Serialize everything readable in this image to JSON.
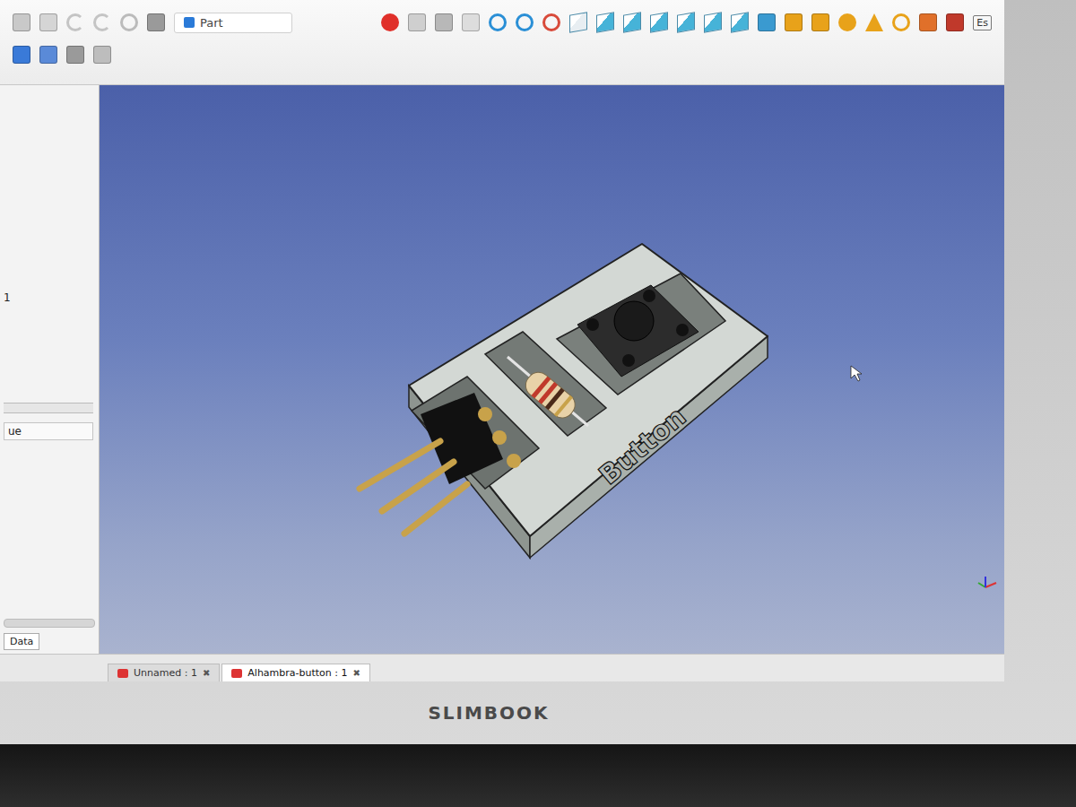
{
  "workbench": {
    "label": "Part"
  },
  "keyboard_layout": "Es",
  "left_panel": {
    "fragments": [
      "1",
      "ue"
    ],
    "tab": "Data"
  },
  "model": {
    "label": "Button"
  },
  "document_tabs": [
    {
      "label": "Unnamed : 1",
      "selected": false,
      "close": "✖"
    },
    {
      "label": "Alhambra-button : 1",
      "selected": true,
      "close": "✖"
    }
  ],
  "laptop": {
    "brand": "SLIMBOOK"
  }
}
